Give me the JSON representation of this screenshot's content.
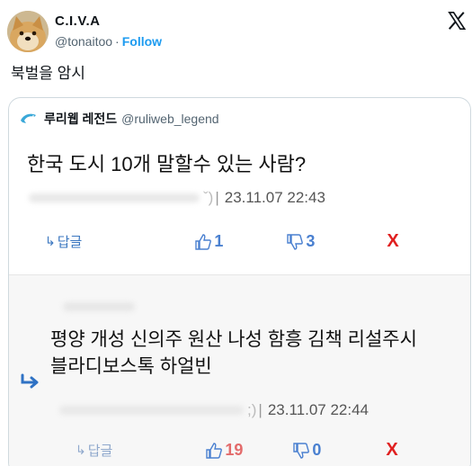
{
  "tweet": {
    "author_name": "C.I.V.A",
    "author_handle": "@tonaitoo",
    "separator": "·",
    "follow_label": "Follow",
    "text": "북벌을 암시"
  },
  "quote": {
    "name": "루리웹 레전드",
    "handle": "@ruliweb_legend",
    "post1": {
      "text": "한국 도시 10개 말할수 있는 사람?",
      "author_tail": "ˇ)",
      "datetime": "23.11.07 22:43",
      "reply_label": "답글",
      "upvotes": "1",
      "downvotes": "3",
      "x_label": "X"
    },
    "post2": {
      "text": "평양 개성 신의주 원산 나성 함흥 김책 리설주시 블라디보스톡 하얼빈",
      "author_tail": ";)",
      "datetime": "23.11.07 22:44",
      "reply_label": "답글",
      "upvotes": "19",
      "downvotes": "0",
      "x_label": "X"
    }
  },
  "colors": {
    "follow": "#1d9bf0",
    "vote": "#4a80d0",
    "x_mark": "#e02020",
    "reply": "#3b77c0"
  },
  "icons": [
    "doge-avatar",
    "x-logo-icon",
    "dolphin-icon",
    "reply-arrow-icon",
    "thumbs-up-icon",
    "thumbs-down-icon"
  ]
}
